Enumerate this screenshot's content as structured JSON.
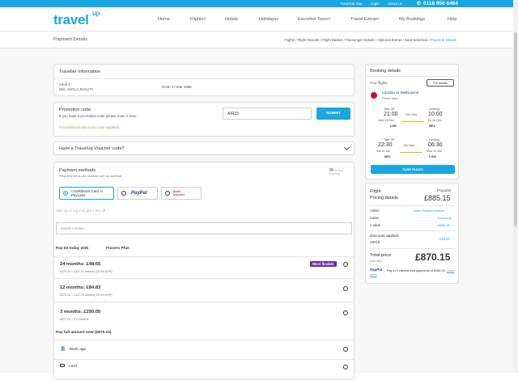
{
  "topbar": {
    "links": [
      "TravelUp App",
      "Login",
      "About us"
    ],
    "phone": "0118 956 6464"
  },
  "header": {
    "logo_text": "travel",
    "logo_sup": "up",
    "nav": [
      "Home",
      "Flights",
      "Hotels",
      "Holidays",
      "Escorted Tours",
      "Travel Extras",
      "My Bookings",
      "Help"
    ]
  },
  "crumbbar": {
    "title": "Payment Details",
    "crumbs": [
      "Flights",
      "Flight Results",
      "Flight Basket",
      "Passenger Details",
      "Optional Extras",
      "Seat Selection"
    ],
    "active": "Payment Details",
    "sep": " / "
  },
  "traveller": {
    "heading": "Traveller Information",
    "type": "Adult 1",
    "name": "Mrs. JHOLA JHOLITA",
    "dob": "DOB: 17 Mar 1999"
  },
  "promo": {
    "heading": "Promotion code",
    "hint": "If you have a promotion code please enter it here.",
    "value": "AIR15",
    "submit": "SUBMIT",
    "applied": "Promotional discount code applied!"
  },
  "voucher": {
    "heading": "Have a TravelUp Voucher code?"
  },
  "payment": {
    "heading": "Payment methods",
    "required": "Required items are marked with an asterisk",
    "secure": "Secure Booking",
    "opt_card": "Credit/Debit Card or PayLater",
    "opt_paypal": "PayPal",
    "opt_bank": "Bank transfer",
    "signup": "Sign up or log in to get 1.5% off",
    "mobile_placeholder": "Mobile number",
    "pay_today": "Pay £0 today with",
    "frasers": "Frasers Plus",
    "plans": [
      {
        "title": "24 months: £48.65",
        "sub": "£870.15 + £297.51 interest (29.9% APR)",
        "badge": "Most flexible"
      },
      {
        "title": "12 months: £84.83",
        "sub": "£870.15 + £147.76 interest (29.9% APR)"
      },
      {
        "title": "3 months: £290.05",
        "sub": "£870.15 + 0% interest"
      }
    ],
    "full_amount": "Pay full amount now (£870.15)",
    "bank_app": "Bank app",
    "card": "Card"
  },
  "booking": {
    "heading": "Booking details",
    "your_flights": "Your flights",
    "full_details": "Full details",
    "route": "London to Melbourne",
    "trip": "Return flight",
    "out": {
      "takeoff_label": "Take Off",
      "takeoff_time": "21:00",
      "takeoff_date": "Wed 24 Dec",
      "from": "LHR",
      "duration": "22h 30m",
      "landing_label": "Landing",
      "landing_time": "10:00",
      "landing_date": "Fri 26 Dec",
      "to": "MEL"
    },
    "ret": {
      "takeoff_label": "Take Off",
      "takeoff_time": "22:30",
      "takeoff_date": "Sat 10 Jan",
      "from": "MEL",
      "duration": "23h 30m",
      "landing_label": "Landing",
      "landing_time": "06:30",
      "landing_date": "Mon 12 Jan",
      "to": "LGW"
    },
    "fare_rules": "FARE RULES"
  },
  "pricing": {
    "flight": "Flight",
    "pricing_details": "Pricing details",
    "payable": "Payable",
    "payable_amount": "£885.15",
    "airline_label": "Airline",
    "airline": "China Eastern Airlines",
    "cabin_label": "Cabin",
    "cabin": "Economy",
    "adult_label": "1 adult",
    "adult_price": "£885.15",
    "discount_label": "Discount applied",
    "discount_code": "AIR15",
    "discount_amount": "£15.00",
    "total_label": "Total price",
    "total_note": "(incl. tax)",
    "total": "£870.15",
    "paypal_logo": "PayPal",
    "paypal_text": "Pay in 3 interest-free payments of £290.05.",
    "learn_more": "Learn more"
  },
  "colors": {
    "accent": "#1aa6e0",
    "promo_green": "#7cc04a",
    "badge_purple": "#6f2da8"
  }
}
